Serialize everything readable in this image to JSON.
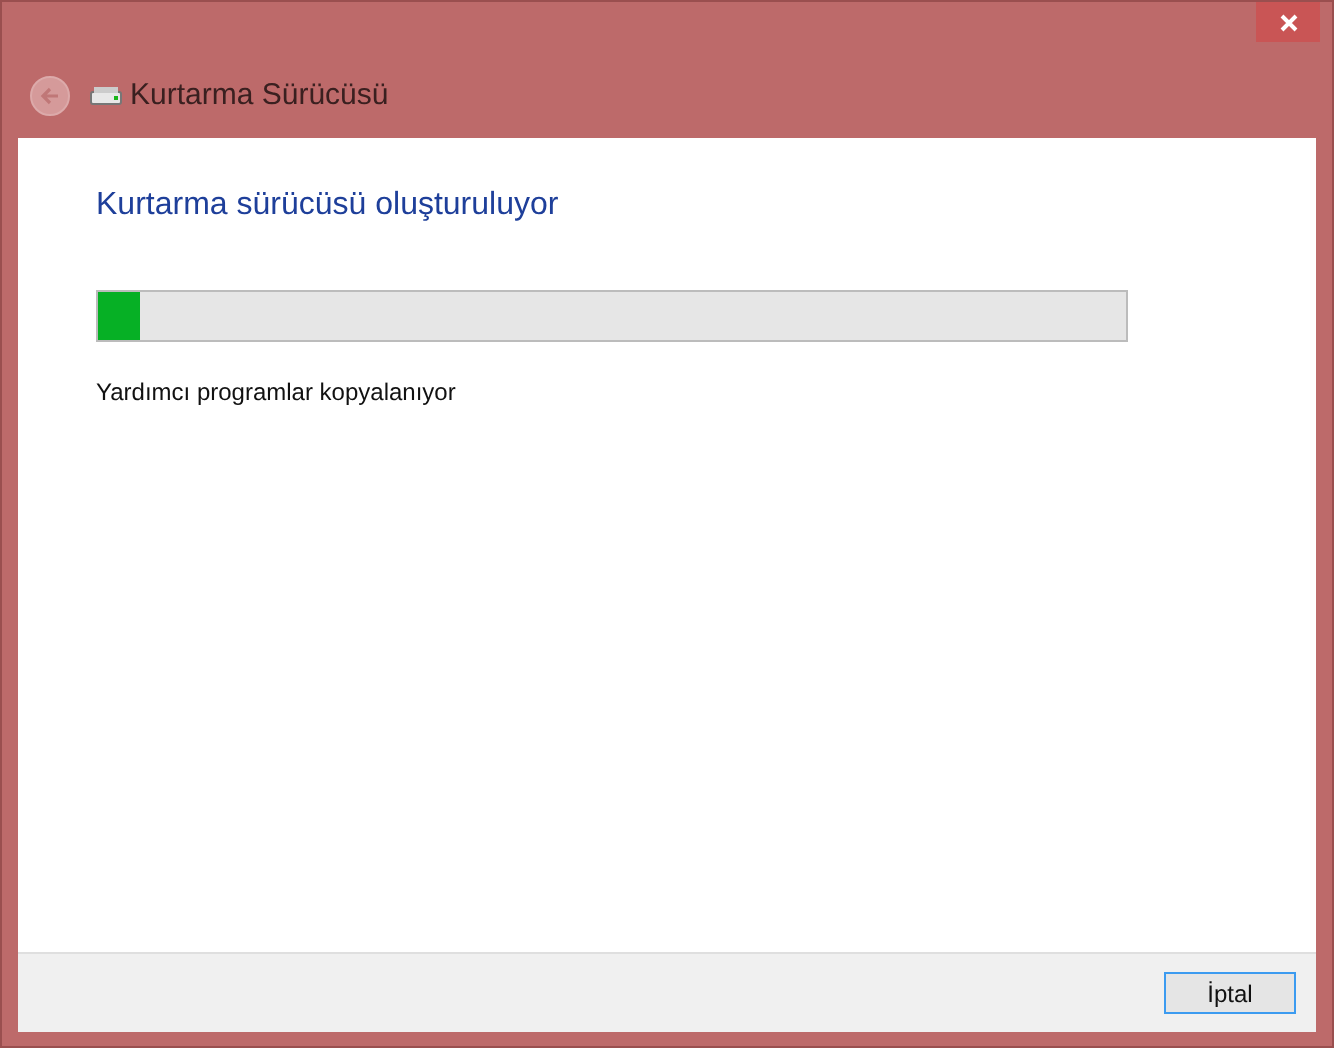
{
  "window": {
    "title": "Kurtarma Sürücüsü"
  },
  "heading": "Kurtarma sürücüsü oluşturuluyor",
  "progress": {
    "level": 0.04
  },
  "status": "Yardımcı programlar kopyalanıyor",
  "buttons": [
    "İptal"
  ]
}
